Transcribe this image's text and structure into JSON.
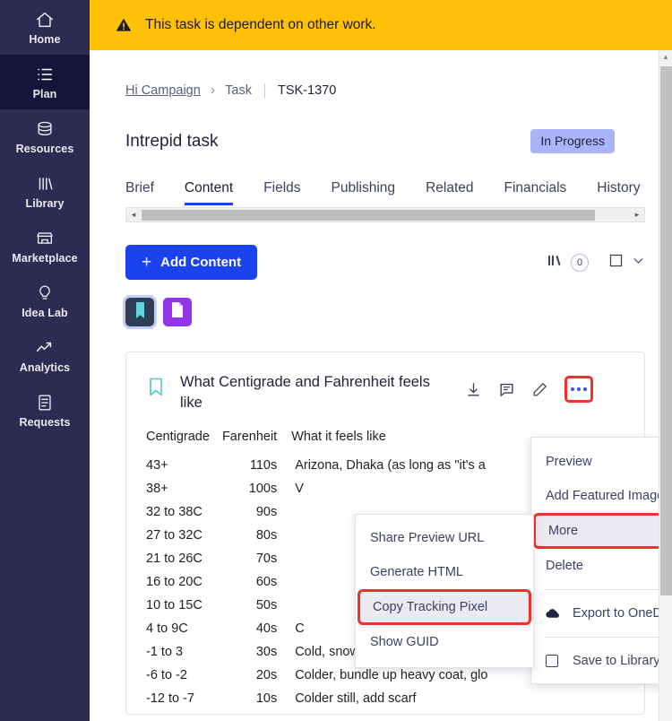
{
  "sidebar": {
    "items": [
      {
        "label": "Home",
        "icon": "home-icon",
        "active": false
      },
      {
        "label": "Plan",
        "icon": "list-icon",
        "active": true
      },
      {
        "label": "Resources",
        "icon": "database-icon",
        "active": false
      },
      {
        "label": "Library",
        "icon": "books-icon",
        "active": false
      },
      {
        "label": "Marketplace",
        "icon": "storefront-icon",
        "active": false
      },
      {
        "label": "Idea Lab",
        "icon": "lightbulb-icon",
        "active": false
      },
      {
        "label": "Analytics",
        "icon": "trend-up-icon",
        "active": false
      },
      {
        "label": "Requests",
        "icon": "document-icon",
        "active": false
      }
    ]
  },
  "banner": {
    "icon": "warning-triangle-icon",
    "text": "This task is dependent on other work.",
    "background": "#ffc107"
  },
  "breadcrumb": {
    "campaign": "Hi Campaign",
    "separator": "›",
    "section": "Task",
    "id": "TSK-1370"
  },
  "header": {
    "title": "Intrepid task",
    "status": "In Progress",
    "status_bg": "#aab4f8"
  },
  "tabs": {
    "items": [
      {
        "label": "Brief",
        "active": false
      },
      {
        "label": "Content",
        "active": true
      },
      {
        "label": "Fields",
        "active": false
      },
      {
        "label": "Publishing",
        "active": false
      },
      {
        "label": "Related",
        "active": false
      },
      {
        "label": "Financials",
        "active": false
      },
      {
        "label": "History",
        "active": false
      }
    ],
    "active_color": "#1a43ef"
  },
  "toolbar": {
    "add_content_label": "Add Content",
    "add_icon": "plus-icon",
    "library_icon": "books-icon",
    "count": "0",
    "select_icon": "checkbox-empty-icon",
    "chevron_icon": "chevron-down-icon"
  },
  "chips": [
    {
      "name": "bookmark-chip",
      "icon": "bookmark-icon",
      "color": "#2f3e54",
      "selected": true
    },
    {
      "name": "document-chip",
      "icon": "document-icon",
      "color": "#9333ea",
      "selected": false
    }
  ],
  "card": {
    "bookmark_icon": "bookmark-outline-icon",
    "title": "What Centigrade and Fahrenheit feels like",
    "actions": [
      {
        "name": "download-icon"
      },
      {
        "name": "comment-icon"
      },
      {
        "name": "edit-pencil-icon"
      },
      {
        "name": "more-options-icon",
        "highlighted": true,
        "highlight_color": "#f03030"
      }
    ]
  },
  "chart_data": {
    "type": "table",
    "title": "What Centigrade and Fahrenheit feels like",
    "columns": [
      "Centigrade",
      "Farenheit",
      "What it feels like"
    ],
    "rows": [
      {
        "centigrade": "43+",
        "farenheit": "110s",
        "feels": "Arizona, Dhaka (as long as \"it's a"
      },
      {
        "centigrade": "38+",
        "farenheit": "100s",
        "feels": "V"
      },
      {
        "centigrade": "32 to 38C",
        "farenheit": "90s",
        "feels": ""
      },
      {
        "centigrade": "27 to 32C",
        "farenheit": "80s",
        "feels": ""
      },
      {
        "centigrade": "21 to 26C",
        "farenheit": "70s",
        "feels": ""
      },
      {
        "centigrade": "16 to 20C",
        "farenheit": "60s",
        "feels": ""
      },
      {
        "centigrade": "10 to 15C",
        "farenheit": "50s",
        "feels": ""
      },
      {
        "centigrade": "4 to 9C",
        "farenheit": "40s",
        "feels": "C"
      },
      {
        "centigrade": "-1 to 3",
        "farenheit": "30s",
        "feels": "Cold, snow possible"
      },
      {
        "centigrade": "-6 to -2",
        "farenheit": "20s",
        "feels": "Colder, bundle up heavy coat, glo"
      },
      {
        "centigrade": "-12 to -7",
        "farenheit": "10s",
        "feels": "Colder still, add scarf"
      }
    ]
  },
  "menu_main": {
    "items": [
      {
        "label": "Preview",
        "submenu": false,
        "highlighted": false,
        "icon": null
      },
      {
        "label": "Add Featured Image",
        "submenu": true,
        "highlighted": false,
        "icon": null
      },
      {
        "label": "More",
        "submenu": true,
        "highlighted": true,
        "icon": null
      },
      {
        "label": "Delete",
        "submenu": false,
        "highlighted": false,
        "icon": null
      },
      {
        "label": "Export to OneDrive",
        "submenu": false,
        "highlighted": false,
        "icon": "cloud-icon"
      },
      {
        "label": "Save to Library",
        "submenu": false,
        "highlighted": false,
        "icon": "checkbox-empty-icon"
      }
    ],
    "highlight_color": "#f03030"
  },
  "menu_sub": {
    "items": [
      {
        "label": "Share Preview URL",
        "highlighted": false
      },
      {
        "label": "Generate HTML",
        "highlighted": false
      },
      {
        "label": "Copy Tracking Pixel",
        "highlighted": true
      },
      {
        "label": "Show GUID",
        "highlighted": false
      }
    ],
    "highlight_color": "#f03030"
  },
  "scrollbars": {
    "tab_left_arrow": "◂",
    "tab_right_arrow": "▸",
    "page_up_arrow": "▲"
  }
}
